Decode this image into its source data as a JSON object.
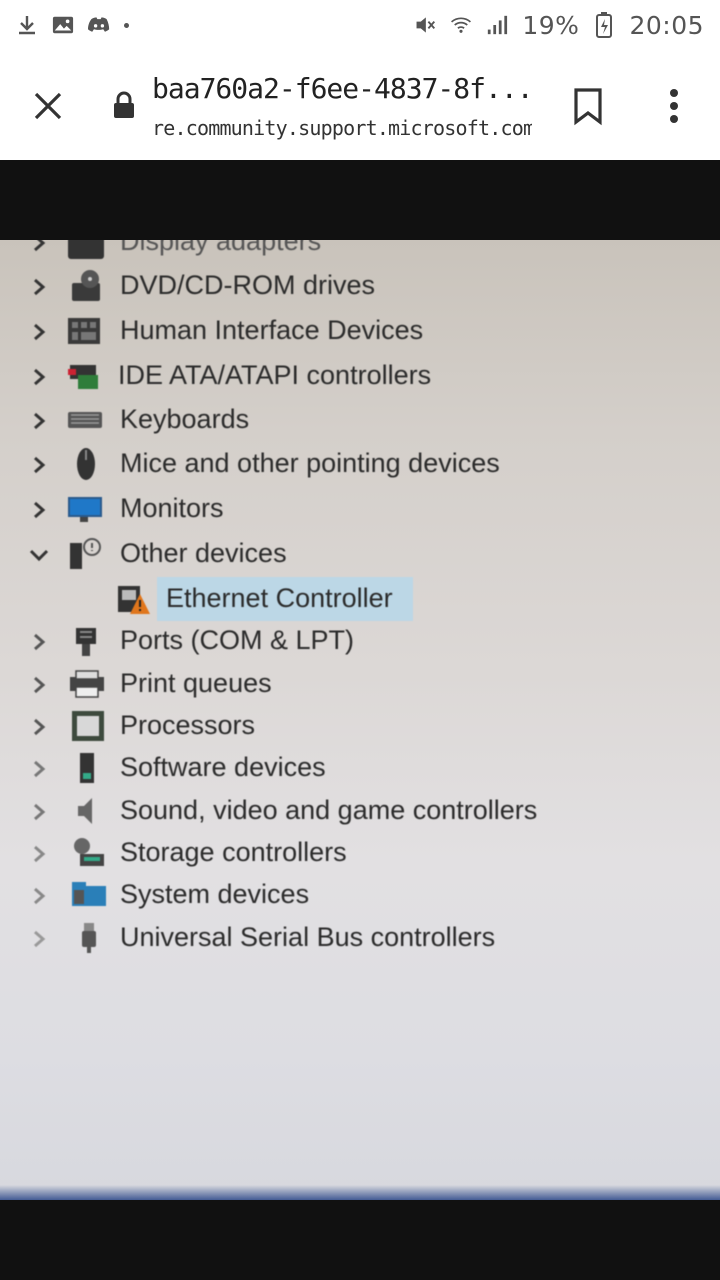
{
  "status_bar": {
    "battery": "19%",
    "time": "20:05",
    "left_icons": [
      "download-icon",
      "image-icon",
      "discord-icon",
      "notification-dot"
    ],
    "right_icons": [
      "mute-icon",
      "wifi-icon",
      "signal-icon",
      "battery-icon"
    ]
  },
  "browser": {
    "page_title": "baa760a2-f6ee-4837-8f...",
    "domain": "re.community.support.microsoft.com",
    "icons": [
      "close-icon",
      "lock-icon",
      "bookmark-icon",
      "more-vert-icon"
    ]
  },
  "device_tree": {
    "partial_top_label": "Display adapters",
    "categories": [
      {
        "label": "DVD/CD-ROM drives",
        "expanded": false,
        "icon": "dvd-drive-icon"
      },
      {
        "label": "Human Interface Devices",
        "expanded": false,
        "icon": "hid-icon"
      },
      {
        "label": "IDE ATA/ATAPI controllers",
        "expanded": false,
        "icon": "ide-controller-icon"
      },
      {
        "label": "Keyboards",
        "expanded": false,
        "icon": "keyboard-icon"
      },
      {
        "label": "Mice and other pointing devices",
        "expanded": false,
        "icon": "mouse-icon"
      },
      {
        "label": "Monitors",
        "expanded": false,
        "icon": "monitor-icon"
      },
      {
        "label": "Other devices",
        "expanded": true,
        "icon": "unknown-device-icon"
      },
      {
        "label": "Ethernet Controller",
        "child": true,
        "selected": true,
        "icon": "warning-device-icon"
      },
      {
        "label": "Ports (COM & LPT)",
        "expanded": false,
        "icon": "port-icon"
      },
      {
        "label": "Print queues",
        "expanded": false,
        "icon": "printer-icon"
      },
      {
        "label": "Processors",
        "expanded": false,
        "icon": "processor-icon"
      },
      {
        "label": "Software devices",
        "expanded": false,
        "icon": "software-device-icon"
      },
      {
        "label": "Sound, video and game controllers",
        "expanded": false,
        "icon": "speaker-icon"
      },
      {
        "label": "Storage controllers",
        "expanded": false,
        "icon": "storage-icon"
      },
      {
        "label": "System devices",
        "expanded": false,
        "icon": "system-folder-icon"
      },
      {
        "label": "Universal Serial Bus controllers",
        "expanded": false,
        "icon": "usb-icon"
      }
    ]
  },
  "colors": {
    "selection": "#bcd7e6",
    "warning": "#e0761c"
  }
}
